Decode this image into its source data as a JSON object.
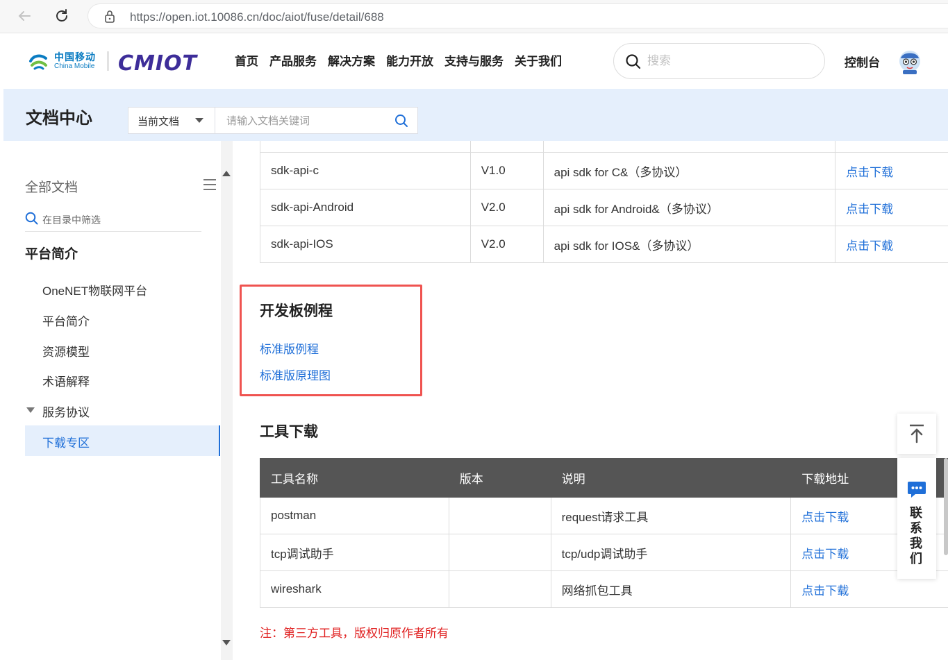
{
  "browser": {
    "url": "https://open.iot.10086.cn/doc/aiot/fuse/detail/688"
  },
  "header": {
    "logo_cn": "中国移动",
    "logo_en": "China Mobile",
    "logo_brand": "CMIOT",
    "nav": [
      "首页",
      "产品服务",
      "解决方案",
      "能力开放",
      "支持与服务",
      "关于我们"
    ],
    "search_placeholder": "搜索",
    "console": "控制台"
  },
  "doc_band": {
    "title": "文档中心",
    "scope_label": "当前文档",
    "search_placeholder": "请输入文档关键词"
  },
  "sidebar": {
    "all_docs": "全部文档",
    "filter_placeholder": "在目录中筛选",
    "section": "平台简介",
    "items": [
      "OneNET物联网平台",
      "平台简介",
      "资源模型",
      "术语解释"
    ],
    "group": "服务协议",
    "active_item": "下载专区"
  },
  "sdk_table": {
    "rows": [
      {
        "name": "sdk-api-c",
        "version": "V1.0",
        "desc": "api sdk for C&（多协议）",
        "link": "点击下载"
      },
      {
        "name": "sdk-api-Android",
        "version": "V2.0",
        "desc": "api sdk for Android&（多协议）",
        "link": "点击下载"
      },
      {
        "name": "sdk-api-IOS",
        "version": "V2.0",
        "desc": "api sdk for IOS&（多协议）",
        "link": "点击下载"
      }
    ]
  },
  "dev_board": {
    "title": "开发板例程",
    "links": [
      "标准版例程",
      "标准版原理图"
    ]
  },
  "tools": {
    "title": "工具下载",
    "headers": [
      "工具名称",
      "版本",
      "说明",
      "下载地址"
    ],
    "rows": [
      {
        "name": "postman",
        "version": "",
        "desc": "request请求工具",
        "link": "点击下载"
      },
      {
        "name": "tcp调试助手",
        "version": "",
        "desc": "tcp/udp调试助手",
        "link": "点击下载"
      },
      {
        "name": "wireshark",
        "version": "",
        "desc": "网络抓包工具",
        "link": "点击下载"
      }
    ],
    "note": "注：第三方工具，版权归原作者所有"
  },
  "float": {
    "contact": "联系我们"
  },
  "colors": {
    "accent": "#1f6fd8",
    "band": "#e5effc",
    "highlight": "#ef5350",
    "note": "#e02020",
    "table_header": "#555555"
  }
}
